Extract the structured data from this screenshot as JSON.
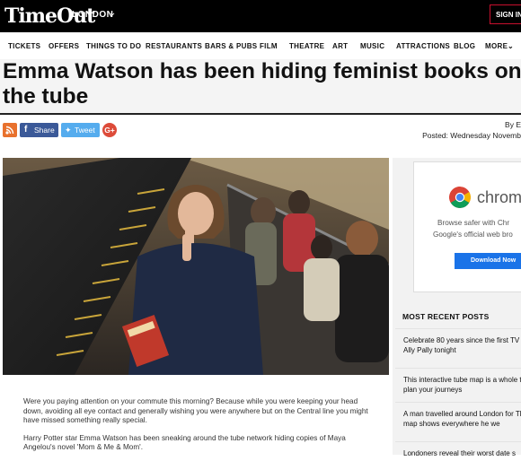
{
  "header": {
    "logo": "TimeOut",
    "city": "LONDON",
    "signin": "SIGN IN O"
  },
  "nav": {
    "items": [
      "TICKETS",
      "OFFERS",
      "THINGS TO DO",
      "RESTAURANTS",
      "BARS & PUBS",
      "FILM",
      "THEATRE",
      "ART",
      "MUSIC",
      "ATTRACTIONS",
      "BLOG",
      "MORE"
    ]
  },
  "article": {
    "headline": "Emma Watson has been hiding feminist books on the tube",
    "byline": "By E",
    "posted": "Posted: Wednesday Novemb",
    "paragraphs": [
      "Were you paying attention on your commute this morning? Because while you were keeping your head down, avoiding all eye contact and generally wishing you were anywhere but on the Central line you might have missed something really special.",
      "Harry Potter star Emma Watson has been sneaking around the tube network hiding copies of Maya Angelou's novel 'Mom & Me & Mom'."
    ]
  },
  "share": {
    "facebook": "Share",
    "twitter": "Tweet",
    "google": "G+"
  },
  "ad": {
    "brand": "chrom",
    "line1": "Browse safer with Chr",
    "line2": "Google's official web bro",
    "button": "Download Now"
  },
  "sidebar": {
    "title": "MOST RECENT POSTS",
    "posts": [
      "Celebrate 80 years since the first TV at Ally Pally tonight",
      "This interactive tube map is a whole to plan your journeys",
      "A man travelled around London for This map shows everywhere he we",
      "Londoners reveal their worst date s"
    ]
  },
  "colors": {
    "brand_red": "#c8102e",
    "facebook": "#3b5998",
    "twitter": "#55acee",
    "google": "#dd4b39",
    "rss": "#e8712d",
    "chrome_button": "#1a73e8"
  }
}
